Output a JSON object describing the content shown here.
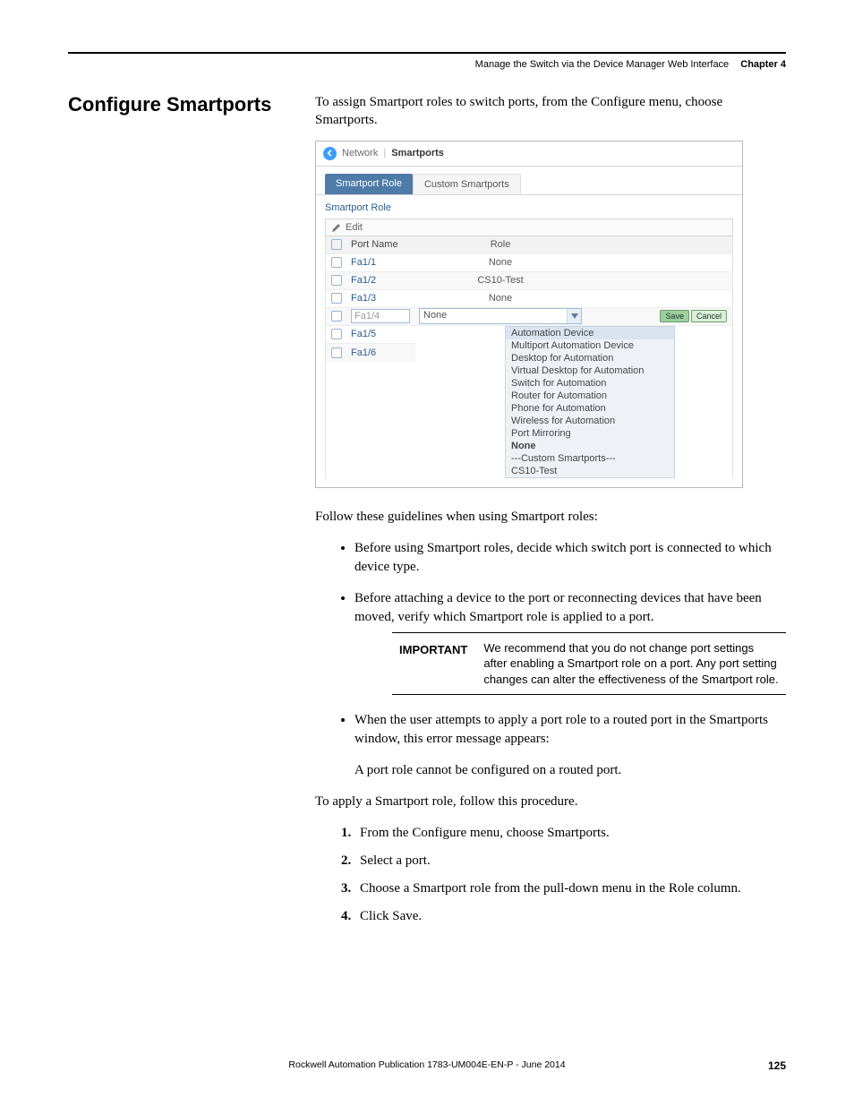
{
  "header": {
    "running": "Manage the Switch via the Device Manager Web Interface",
    "chapter": "Chapter 4"
  },
  "section_title": "Configure Smartports",
  "intro": "To assign Smartport roles to switch ports, from the Configure menu, choose Smartports.",
  "shot": {
    "crumb": {
      "net": "Network",
      "sp": "Smartports"
    },
    "tabs": {
      "active": "Smartport Role",
      "inactive": "Custom Smartports"
    },
    "panel_title": "Smartport Role",
    "edit_label": "Edit",
    "cols": {
      "name": "Port Name",
      "role": "Role"
    },
    "rows": [
      {
        "name": "Fa1/1",
        "role": "None"
      },
      {
        "name": "Fa1/2",
        "role": "CS10-Test"
      },
      {
        "name": "Fa1/3",
        "role": "None"
      }
    ],
    "editing": {
      "name": "Fa1/4",
      "role": "None",
      "save": "Save",
      "cancel": "Cancel"
    },
    "below_rows": [
      {
        "name": "Fa1/5"
      },
      {
        "name": "Fa1/6"
      }
    ],
    "dropdown": [
      "Automation Device",
      "Multiport Automation Device",
      "Desktop for Automation",
      "Virtual Desktop for Automation",
      "Switch for Automation",
      "Router for Automation",
      "Phone for Automation",
      "Wireless for Automation",
      "Port Mirroring",
      "None",
      "---Custom Smartports---",
      "CS10-Test"
    ]
  },
  "guidelines_intro": "Follow these guidelines when using Smartport roles:",
  "bullets": {
    "b1": "Before using Smartport roles, decide which switch port is connected to which device type.",
    "b2": "Before attaching a device to the port or reconnecting devices that have been moved, verify which Smartport role is applied to a port.",
    "b3": "When the user attempts to apply a port role to a routed port in the Smartports window, this error message appears:",
    "b3_sub": "A port role cannot be configured on a routed port."
  },
  "important": {
    "label": "IMPORTANT",
    "text": "We recommend that you do not change port settings after enabling a Smartport role on a port. Any port setting changes can alter the effectiveness of the Smartport role."
  },
  "apply_intro": "To apply a Smartport role, follow this procedure.",
  "steps": {
    "s1": "From the Configure menu, choose Smartports.",
    "s2": "Select a port.",
    "s3": "Choose a Smartport role from the pull-down menu in the Role column.",
    "s4": "Click Save."
  },
  "footer": {
    "pub": "Rockwell Automation Publication 1783-UM004E-EN-P - June 2014",
    "page": "125"
  }
}
